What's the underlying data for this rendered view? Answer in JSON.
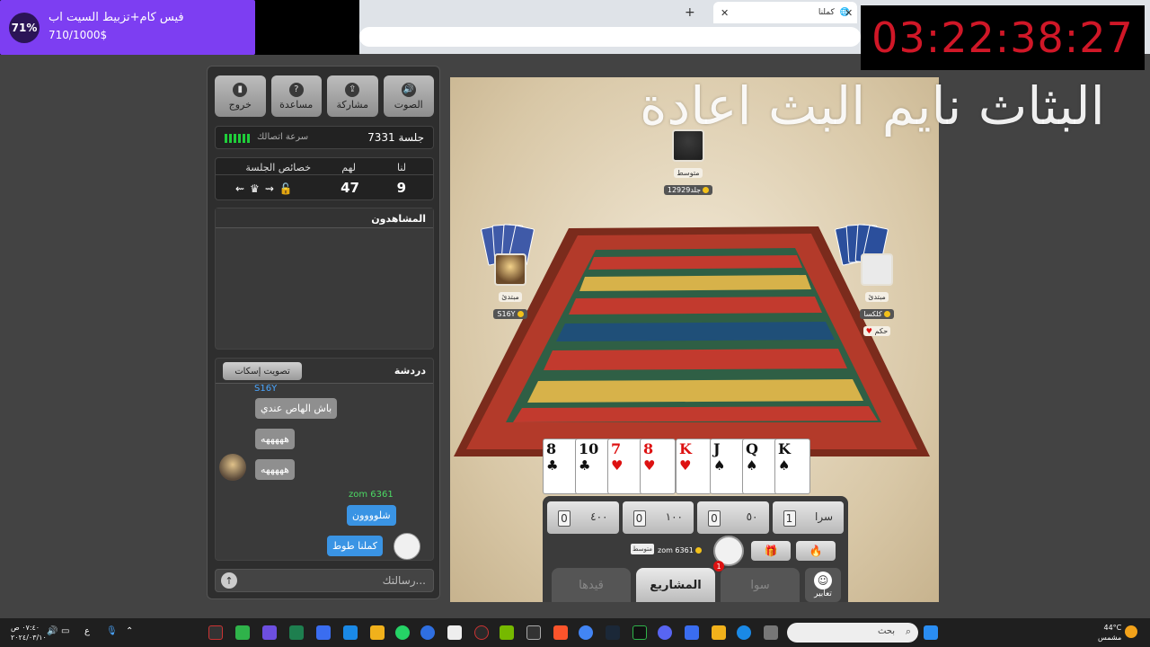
{
  "browser": {
    "active_tab_title": "كملنا",
    "new_tab_label": "+"
  },
  "donation": {
    "percent": "71%",
    "title": "فيس كام+تزبيط السيت اب",
    "amount": "710/1000$"
  },
  "timer": {
    "value": "03:22:38:27"
  },
  "watermark": {
    "text": "البثاث نايم البث اعادة"
  },
  "toolbar": {
    "sound_label": "الصوت",
    "share_label": "مشاركة",
    "help_label": "مساعدة",
    "exit_label": "خروج"
  },
  "session": {
    "label": "جلسة 7331",
    "connection_label": "سرعة اتصالك"
  },
  "scores": {
    "us_header": "لنا",
    "them_header": "لهم",
    "props_header": "خصائص الجلسة",
    "us_value": "9",
    "them_value": "47",
    "icons": "⇜♛⇝🔓"
  },
  "viewers": {
    "title": "المشاهدون"
  },
  "chat": {
    "title": "دردشة",
    "mute_label": "تصويت إسكات",
    "messages": [
      {
        "sender": "S16Y",
        "text": "باش الهاص عندي"
      },
      {
        "text": "هههههه"
      },
      {
        "text": "هههههه"
      },
      {
        "sender": "zom 6361",
        "text": "شلوووون"
      },
      {
        "text": "كملنا طوط"
      }
    ],
    "input_placeholder": "رسالتك..."
  },
  "players": {
    "top": {
      "level": "متوسط",
      "name": "جلد12929"
    },
    "left": {
      "level": "مبتدئ",
      "name": "S16Y"
    },
    "right": {
      "level": "مبتدئ",
      "name": "كلكسا",
      "extra": "حكم"
    }
  },
  "hand": [
    {
      "rank": "8",
      "suit": "♣",
      "color": "blk"
    },
    {
      "rank": "10",
      "suit": "♣",
      "color": "blk"
    },
    {
      "rank": "7",
      "suit": "♥",
      "color": "red"
    },
    {
      "rank": "8",
      "suit": "♥",
      "color": "red"
    },
    {
      "rank": "K",
      "suit": "♥",
      "color": "red"
    },
    {
      "rank": "J",
      "suit": "♠",
      "color": "blk"
    },
    {
      "rank": "Q",
      "suit": "♠",
      "color": "blk"
    },
    {
      "rank": "K",
      "suit": "♠",
      "color": "blk"
    }
  ],
  "bids": [
    {
      "num": "0",
      "label": "٤٠٠"
    },
    {
      "num": "0",
      "label": "١٠٠"
    },
    {
      "num": "0",
      "label": "٥٠"
    },
    {
      "num": "1",
      "label": "سرا"
    }
  ],
  "me": {
    "name": "zom 6361",
    "level": "متوسط"
  },
  "actions": {
    "qaidha": "قيدها",
    "projects": "المشاريع",
    "projects_badge": "1",
    "sawa": "سوا",
    "emotes": "تعابير"
  },
  "taskbar": {
    "search_placeholder": "بحث",
    "time": "٠٧:٤٠ ص",
    "date": "٢٠٢٤/٠٣/١٠",
    "lang": "ع",
    "temp": "44°C",
    "weather": "مشمس"
  }
}
